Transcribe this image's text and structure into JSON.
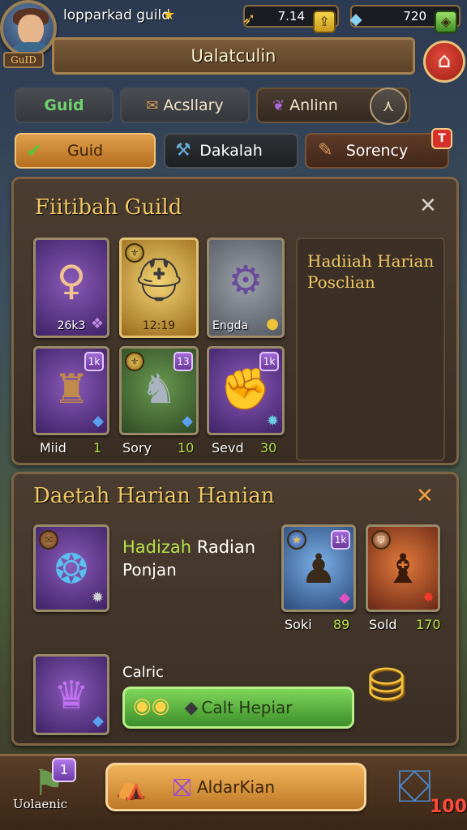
{
  "header": {
    "avatar_tag": "GuID",
    "player_name": "lopparkad guild",
    "resource1_value": "7.14",
    "resource2_value": "720",
    "title": "Ualatculin"
  },
  "tabs_row1": [
    {
      "label": "Guid"
    },
    {
      "label": "Acsllary"
    },
    {
      "label": "Anlinn"
    }
  ],
  "tabs_row2": [
    {
      "label": "Guid"
    },
    {
      "label": "Dakalah"
    },
    {
      "label": "Sorency",
      "badge": "T"
    }
  ],
  "panel1": {
    "title": "Fiitibah Guild",
    "cards_top": [
      {
        "value": "26k3"
      },
      {
        "value": "12:19"
      },
      {
        "value": "Engda"
      }
    ],
    "cards_bottom": [
      {
        "badge": "1k",
        "name": "Miid",
        "number": "1"
      },
      {
        "badge": "13",
        "name": "Sory",
        "number": "10"
      },
      {
        "badge": "1k",
        "name": "Sevd",
        "number": "30"
      }
    ],
    "reward_text_line1": "Hadiiah Harian",
    "reward_text_line2": "Posclian"
  },
  "panel2": {
    "title": "Daetah Harian Hanian",
    "headline_green": "Hadizah",
    "headline_white": "Radian",
    "subline": "Ponjan",
    "card1_badge": "1k",
    "card1_name": "Soki",
    "card1_number": "89",
    "card2_name": "Sold",
    "card2_number": "170",
    "calric_label": "Calric",
    "claim_button_label": "Calt Hepiar"
  },
  "bottom": {
    "left_badge": "1",
    "left_label": "Uolaenic",
    "main_button_label": "AldarKian",
    "right_number": "100"
  }
}
